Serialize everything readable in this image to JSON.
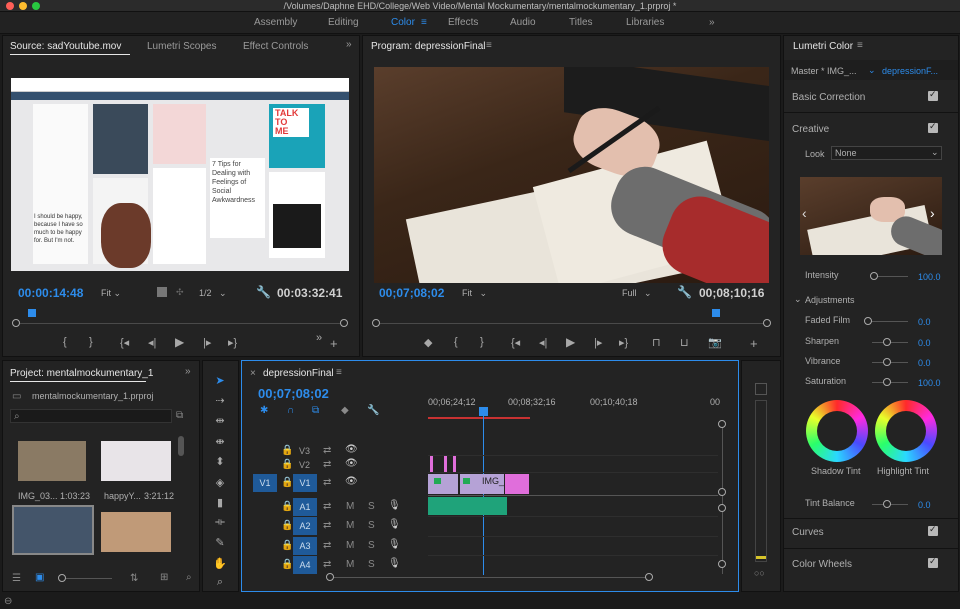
{
  "window": {
    "title": "/Volumes/Daphne EHD/College/Web Video/Mental Mockumentary/mentalmockumentary_1.prproj *"
  },
  "workspaces": [
    {
      "label": "Assembly"
    },
    {
      "label": "Editing"
    },
    {
      "label": "Color"
    },
    {
      "label": "Effects"
    },
    {
      "label": "Audio"
    },
    {
      "label": "Titles"
    },
    {
      "label": "Libraries"
    }
  ],
  "source": {
    "tabs": [
      "Source: sadYoutube.mov",
      "Lumetri Scopes",
      "Effect Controls"
    ],
    "timecode": "00:00:14:48",
    "fit": "Fit",
    "resolution": "1/2",
    "duration": "00:03:32:41",
    "thumb_text": {
      "talk": "TALK",
      "to": "TO",
      "me": "ME",
      "post": "7 Tips for Dealing with Feelings of Social Awkwardness",
      "quote": "I should be happy, because I have so much to be happy for. But I'm not."
    }
  },
  "program": {
    "title": "Program: depressionFinal",
    "timecode": "00;07;08;02",
    "fit": "Fit",
    "resolution": "Full",
    "duration": "00;08;10;16"
  },
  "project": {
    "title": "Project: mentalmockumentary_1",
    "file": "mentalmockumentary_1.prproj",
    "items": [
      {
        "name": "IMG_03...",
        "duration": "1:03:23"
      },
      {
        "name": "happyY...",
        "duration": "3:21:12"
      },
      {
        "name": "",
        "duration": ""
      },
      {
        "name": "",
        "duration": ""
      }
    ]
  },
  "timeline": {
    "sequence": "depressionFinal",
    "timecode": "00;07;08;02",
    "ruler": [
      "00;06;24;12",
      "00;08;32;16",
      "00;10;40;18",
      "00"
    ],
    "tracks": [
      {
        "name": "V3",
        "toggle": ""
      },
      {
        "name": "V2",
        "toggle": ""
      },
      {
        "name": "V1",
        "toggle": "V1"
      },
      {
        "name": "A1",
        "toggle": ""
      },
      {
        "name": "A2",
        "toggle": ""
      },
      {
        "name": "A3",
        "toggle": ""
      },
      {
        "name": "A4",
        "toggle": ""
      }
    ],
    "clip_label": "IMG_",
    "m_label": "M",
    "s_label": "S"
  },
  "lumetri": {
    "title": "Lumetri Color",
    "master": "Master * IMG_...",
    "sequence": "depressionF...",
    "basic": "Basic Correction",
    "creative": "Creative",
    "look_label": "Look",
    "look_value": "None",
    "intensity_label": "Intensity",
    "intensity_value": "100.0",
    "adjustments": "Adjustments",
    "faded_label": "Faded Film",
    "faded_value": "0.0",
    "sharpen_label": "Sharpen",
    "sharpen_value": "0.0",
    "vibrance_label": "Vibrance",
    "vibrance_value": "0.0",
    "saturation_label": "Saturation",
    "saturation_value": "100.0",
    "shadow_tint": "Shadow Tint",
    "highlight_tint": "Highlight Tint",
    "tint_balance_label": "Tint Balance",
    "tint_balance_value": "0.0",
    "curves": "Curves",
    "color_wheels": "Color Wheels"
  },
  "colors": {
    "accent": "#2d8ceb",
    "panel": "#232323",
    "playhead": "#2d8ceb",
    "clip_video": "#b5a2d6",
    "clip_audio": "#1fa37a",
    "marker": "#e06edb"
  }
}
